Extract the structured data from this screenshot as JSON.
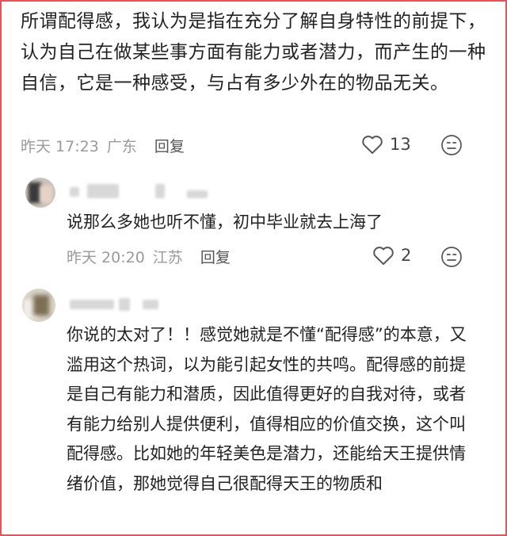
{
  "comment1": {
    "text": "所谓配得感，我认为是指在充分了解自身特性的前提下，认为自己在做某些事方面有能力或者潜力，而产生的一种自信，它是一种感受，与占有多少外在的物品无关。",
    "time": "昨天 17:23",
    "location": "广东",
    "reply_label": "回复",
    "likes": "13"
  },
  "comment2": {
    "text": "说那么多她也听不懂，初中毕业就去上海了",
    "time": "昨天 20:20",
    "location": "江苏",
    "reply_label": "回复",
    "likes": "2"
  },
  "comment3": {
    "text": "你说的太对了！！感觉她就是不懂“配得感”的本意，又滥用这个热词，以为能引起女性的共鸣。配得感的前提是自己有能力和潜质，因此值得更好的自我对待，或者有能力给别人提供便利，值得相应的价值交换，这个叫配得感。比如她的年轻美色是潜力，还能给天王提供情绪价值，那她觉得自己很配得天王的物质和"
  },
  "icons": {
    "like": "heart-icon",
    "emoji": "neutral-face-icon"
  },
  "colors": {
    "frame": "#e8535a",
    "meta": "#9a9a9a",
    "text": "#222222"
  }
}
